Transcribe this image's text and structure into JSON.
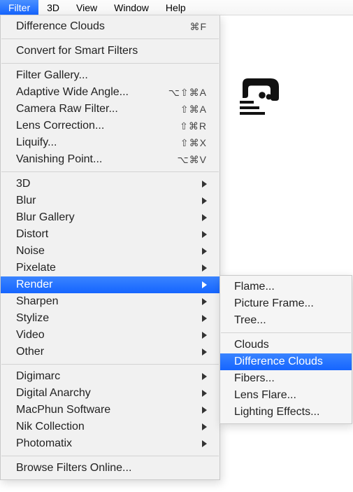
{
  "menubar": {
    "items": [
      {
        "label": "Filter",
        "active": true
      },
      {
        "label": "3D"
      },
      {
        "label": "View"
      },
      {
        "label": "Window"
      },
      {
        "label": "Help"
      }
    ]
  },
  "dropdown": {
    "groups": [
      [
        {
          "label": "Difference Clouds",
          "shortcut": "⌘F"
        }
      ],
      [
        {
          "label": "Convert for Smart Filters"
        }
      ],
      [
        {
          "label": "Filter Gallery..."
        },
        {
          "label": "Adaptive Wide Angle...",
          "shortcut": "⌥⇧⌘A"
        },
        {
          "label": "Camera Raw Filter...",
          "shortcut": "⇧⌘A"
        },
        {
          "label": "Lens Correction...",
          "shortcut": "⇧⌘R"
        },
        {
          "label": "Liquify...",
          "shortcut": "⇧⌘X"
        },
        {
          "label": "Vanishing Point...",
          "shortcut": "⌥⌘V"
        }
      ],
      [
        {
          "label": "3D",
          "arrow": true
        },
        {
          "label": "Blur",
          "arrow": true
        },
        {
          "label": "Blur Gallery",
          "arrow": true
        },
        {
          "label": "Distort",
          "arrow": true
        },
        {
          "label": "Noise",
          "arrow": true
        },
        {
          "label": "Pixelate",
          "arrow": true
        },
        {
          "label": "Render",
          "arrow": true,
          "highlighted": true
        },
        {
          "label": "Sharpen",
          "arrow": true
        },
        {
          "label": "Stylize",
          "arrow": true
        },
        {
          "label": "Video",
          "arrow": true
        },
        {
          "label": "Other",
          "arrow": true
        }
      ],
      [
        {
          "label": "Digimarc",
          "arrow": true
        },
        {
          "label": "Digital Anarchy",
          "arrow": true
        },
        {
          "label": "MacPhun Software",
          "arrow": true
        },
        {
          "label": "Nik Collection",
          "arrow": true
        },
        {
          "label": "Photomatix",
          "arrow": true
        }
      ],
      [
        {
          "label": "Browse Filters Online..."
        }
      ]
    ]
  },
  "submenu": {
    "groups": [
      [
        {
          "label": "Flame..."
        },
        {
          "label": "Picture Frame..."
        },
        {
          "label": "Tree..."
        }
      ],
      [
        {
          "label": "Clouds"
        },
        {
          "label": "Difference Clouds",
          "highlighted": true
        },
        {
          "label": "Fibers..."
        },
        {
          "label": "Lens Flare..."
        },
        {
          "label": "Lighting Effects..."
        }
      ]
    ]
  }
}
